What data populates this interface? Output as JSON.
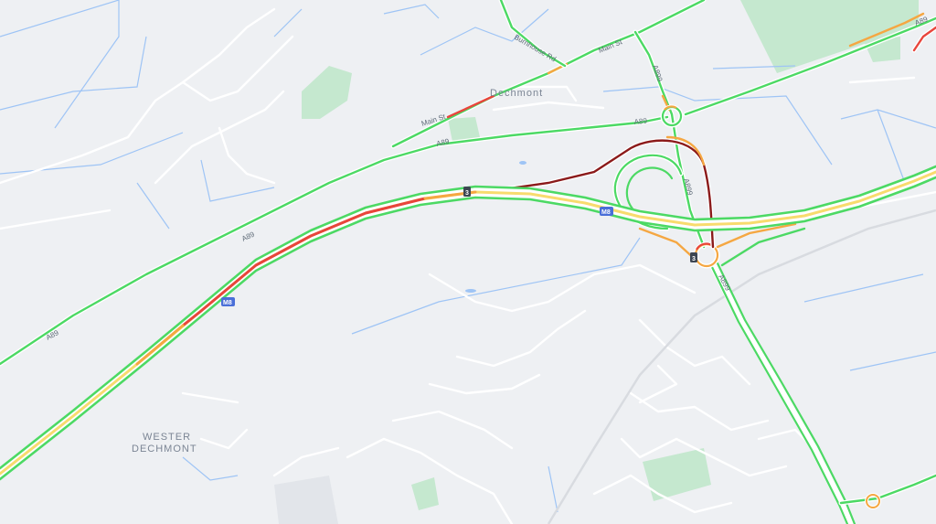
{
  "map": {
    "background_color": "#eef0f3",
    "places": [
      {
        "id": "dechmont",
        "text": "Dechmont"
      },
      {
        "id": "wester",
        "text": "WESTER"
      },
      {
        "id": "wester-dechmont",
        "text": "DECHMONT"
      }
    ],
    "road_labels": {
      "a89_west": "A89",
      "a89_mid": "A89",
      "a89_north": "A89",
      "a89_east": "A89",
      "a899_north": "A899",
      "a899_mid": "A899",
      "a899_south": "A899",
      "main_st_1": "Main St",
      "main_st_2": "Main St",
      "burnhouse_rd": "Burnhouse Rd",
      "a89_top_right": "A89"
    },
    "shields": {
      "m8_west": "M8",
      "m8_mid": "M8",
      "junction_north": "3",
      "junction_south": "3"
    },
    "traffic_colors": {
      "fast": "#4cd964",
      "moderate": "#f5a742",
      "slow": "#e8453c",
      "very_slow": "#8b1a1a"
    },
    "colors": {
      "water": "#9ec4f5",
      "green_area": "#c5e8cf",
      "minor_road": "#ffffff",
      "motorway_shield": "#4a6fd8"
    }
  }
}
